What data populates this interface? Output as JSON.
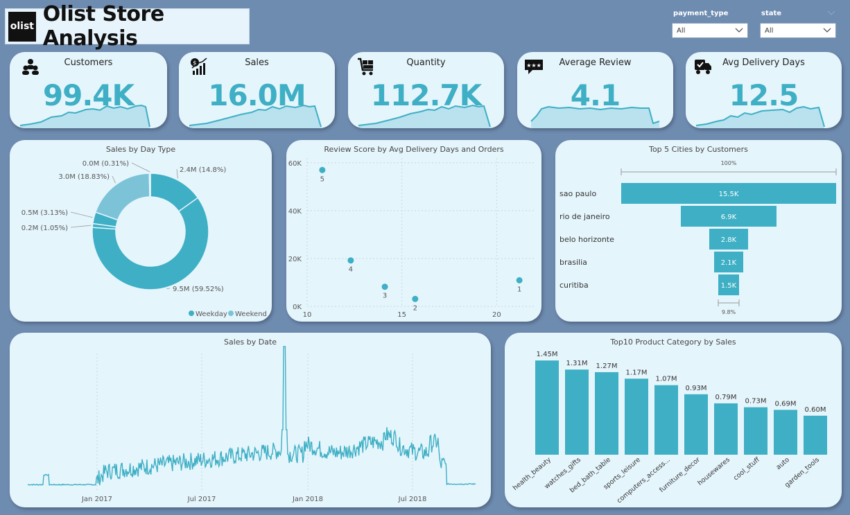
{
  "header": {
    "logo_text": "olist",
    "title": "Olist Store Analysis"
  },
  "slicers": [
    {
      "label": "payment_type",
      "value": "All"
    },
    {
      "label": "state",
      "value": "All"
    }
  ],
  "kpis": [
    {
      "label": "Customers",
      "value": "99.4K",
      "icon": "customers-icon"
    },
    {
      "label": "Sales",
      "value": "16.0M",
      "icon": "sales-growth-icon"
    },
    {
      "label": "Quantity",
      "value": "112.7K",
      "icon": "cart-icon"
    },
    {
      "label": "Average Review",
      "value": "4.1",
      "icon": "rating-stars-icon"
    },
    {
      "label": "Avg Delivery Days",
      "value": "12.5",
      "icon": "delivery-truck-icon"
    }
  ],
  "colors": {
    "accent": "#3eafc4",
    "accent_light": "#7cc3d8",
    "background": "#6e8bb0",
    "card": "#e5f5fc"
  },
  "chart_data": [
    {
      "id": "donut",
      "type": "pie",
      "title": "Sales by Day Type",
      "legend": [
        "Weekday",
        "Weekend"
      ],
      "legend_colors": [
        "#3eafc4",
        "#7cc3d8"
      ],
      "slices": [
        {
          "label": "2.4M (14.8%)",
          "value": 14.8,
          "group": "Weekday"
        },
        {
          "label": "9.5M (59.52%)",
          "value": 59.52,
          "group": "Weekday"
        },
        {
          "label": "0.2M (1.05%)",
          "value": 1.05,
          "group": "Weekday"
        },
        {
          "label": "0.5M (3.13%)",
          "value": 3.13,
          "group": "Weekday"
        },
        {
          "label": "3.0M (18.83%)",
          "value": 18.83,
          "group": "Weekend"
        },
        {
          "label": "0.0M (0.31%)",
          "value": 0.31,
          "group": "Weekend"
        }
      ]
    },
    {
      "id": "scatter",
      "type": "scatter",
      "title": "Review Score by Avg Delivery Days and Orders",
      "xlim": [
        10,
        22
      ],
      "ylim": [
        0,
        62000
      ],
      "xticks": [
        10,
        15,
        20
      ],
      "yticks": [
        0,
        20000,
        40000,
        60000
      ],
      "ytick_labels": [
        "0K",
        "20K",
        "40K",
        "60K"
      ],
      "points": [
        {
          "label": "5",
          "x": 10.8,
          "y": 57000
        },
        {
          "label": "4",
          "x": 12.3,
          "y": 19200
        },
        {
          "label": "3",
          "x": 14.1,
          "y": 8200
        },
        {
          "label": "2",
          "x": 15.7,
          "y": 3100
        },
        {
          "label": "1",
          "x": 21.2,
          "y": 10900
        }
      ]
    },
    {
      "id": "funnel",
      "type": "bar",
      "title": "Top 5 Cities by Customers",
      "top_label": "100%",
      "bottom_label": "9.8%",
      "categories": [
        "sao paulo",
        "rio de janeiro",
        "belo horizonte",
        "brasilia",
        "curitiba"
      ],
      "values": [
        15.5,
        6.9,
        2.8,
        2.1,
        1.5
      ],
      "value_labels": [
        "15.5K",
        "6.9K",
        "2.8K",
        "2.1K",
        "1.5K"
      ]
    },
    {
      "id": "line",
      "type": "line",
      "title": "Sales by Date",
      "xticks": [
        "Jan 2017",
        "Jul 2017",
        "Jan 2018",
        "Jul 2018"
      ],
      "x_range": [
        "2016-09",
        "2018-10"
      ],
      "note": "daily sales series; peak near late Nov 2017"
    },
    {
      "id": "columns",
      "type": "bar",
      "title": "Top10 Product Category by Sales",
      "categories": [
        "health_beauty",
        "watches_gifts",
        "bed_bath_table",
        "sports_leisure",
        "computers_access...",
        "furniture_decor",
        "housewares",
        "cool_stuff",
        "auto",
        "garden_tools"
      ],
      "values": [
        1.45,
        1.31,
        1.27,
        1.17,
        1.07,
        0.93,
        0.79,
        0.73,
        0.69,
        0.6
      ],
      "value_labels": [
        "1.45M",
        "1.31M",
        "1.27M",
        "1.17M",
        "1.07M",
        "0.93M",
        "0.79M",
        "0.73M",
        "0.69M",
        "0.60M"
      ],
      "ylim": [
        0,
        1.6
      ]
    }
  ]
}
